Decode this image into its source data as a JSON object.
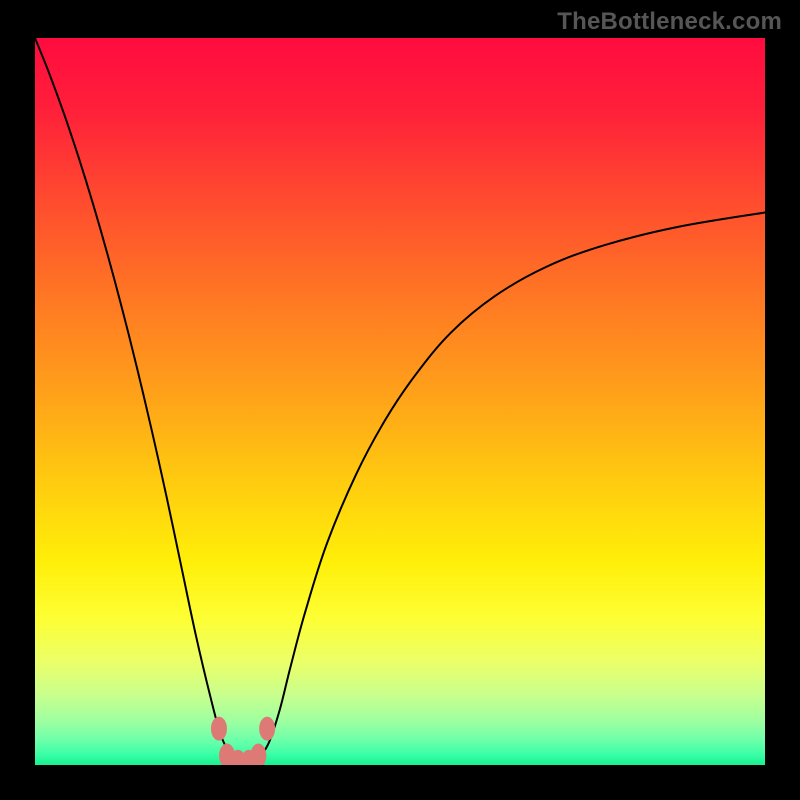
{
  "watermark": "TheBottleneck.com",
  "chart_data": {
    "type": "line",
    "title": "",
    "xlabel": "",
    "ylabel": "",
    "xlim": [
      0,
      100
    ],
    "ylim": [
      0,
      100
    ],
    "grid": false,
    "legend": false,
    "annotations": [],
    "background": {
      "type": "vertical-gradient",
      "stops": [
        {
          "pos": 0.0,
          "color": "#ff0b3f"
        },
        {
          "pos": 0.1,
          "color": "#ff203a"
        },
        {
          "pos": 0.22,
          "color": "#ff4a2f"
        },
        {
          "pos": 0.35,
          "color": "#ff7524"
        },
        {
          "pos": 0.48,
          "color": "#ff9e1a"
        },
        {
          "pos": 0.6,
          "color": "#ffc810"
        },
        {
          "pos": 0.72,
          "color": "#ffef09"
        },
        {
          "pos": 0.8,
          "color": "#fdff35"
        },
        {
          "pos": 0.86,
          "color": "#eaff6a"
        },
        {
          "pos": 0.905,
          "color": "#c7ff8e"
        },
        {
          "pos": 0.94,
          "color": "#9dffa0"
        },
        {
          "pos": 0.965,
          "color": "#6fffaa"
        },
        {
          "pos": 0.985,
          "color": "#3bffa6"
        },
        {
          "pos": 1.0,
          "color": "#17f08f"
        }
      ]
    },
    "series": [
      {
        "name": "bottleneck-curve",
        "stroke": "#000000",
        "stroke_width": 2,
        "x": [
          0.0,
          2.0,
          4.0,
          6.0,
          8.0,
          10.0,
          12.0,
          14.0,
          16.0,
          18.0,
          20.0,
          22.0,
          24.0,
          25.5,
          27.0,
          28.2,
          29.2,
          30.5,
          32.0,
          33.5,
          35.0,
          37.0,
          40.0,
          44.0,
          48.0,
          52.0,
          57.0,
          63.0,
          70.0,
          78.0,
          88.0,
          100.0
        ],
        "y": [
          100.0,
          95.0,
          89.5,
          83.5,
          77.0,
          70.0,
          62.5,
          54.5,
          46.0,
          37.0,
          27.5,
          18.0,
          9.5,
          4.0,
          1.2,
          0.3,
          0.3,
          0.9,
          3.0,
          7.5,
          13.5,
          21.0,
          30.5,
          40.0,
          47.5,
          53.5,
          59.5,
          64.5,
          68.5,
          71.5,
          74.0,
          76.0
        ]
      }
    ],
    "markers": {
      "name": "notch-markers",
      "fill": "#dd7a76",
      "rx": 8,
      "points": [
        {
          "x": 25.2,
          "y": 5.0
        },
        {
          "x": 26.3,
          "y": 1.3
        },
        {
          "x": 27.8,
          "y": 0.45
        },
        {
          "x": 29.3,
          "y": 0.45
        },
        {
          "x": 30.6,
          "y": 1.3
        },
        {
          "x": 31.8,
          "y": 5.0
        }
      ]
    }
  }
}
